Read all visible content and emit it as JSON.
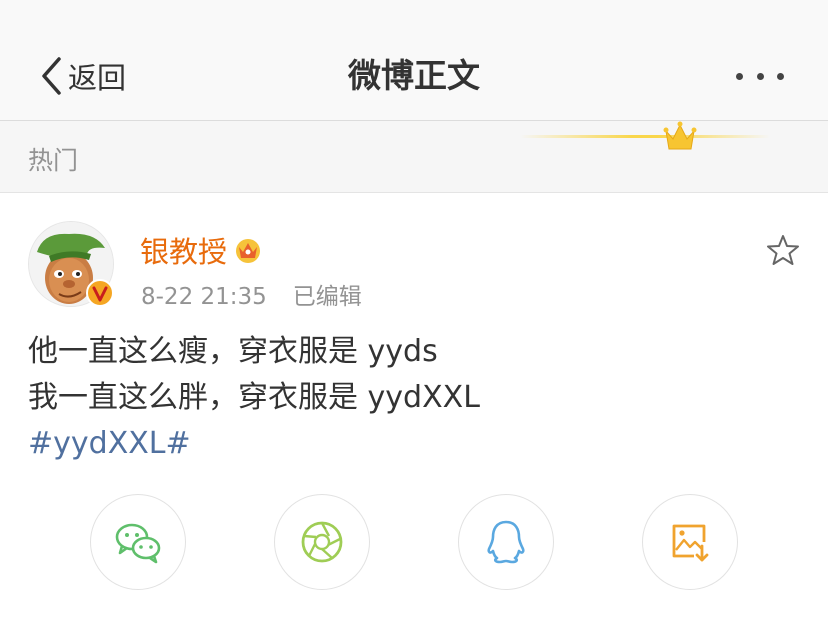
{
  "nav": {
    "back_label": "返回",
    "title": "微博正文"
  },
  "section": {
    "label": "热门"
  },
  "post": {
    "username": "银教授",
    "time": "8-22 21:35",
    "edited": "已编辑",
    "lines": [
      "他一直这么瘦，穿衣服是 yyds",
      "我一直这么胖，穿衣服是 yydXXL"
    ],
    "hashtag": "#yydXXL#"
  },
  "share": [
    {
      "icon": "wechat-icon",
      "color": "#5fbf6b"
    },
    {
      "icon": "moments-icon",
      "color": "#9fcd55"
    },
    {
      "icon": "qq-icon",
      "color": "#5aa8e0"
    },
    {
      "icon": "save-image-icon",
      "color": "#f0a32e"
    }
  ],
  "colors": {
    "username": "#e86b0c",
    "hashtag": "#50709f",
    "muted": "#939393",
    "gold": "#f9d64a"
  }
}
